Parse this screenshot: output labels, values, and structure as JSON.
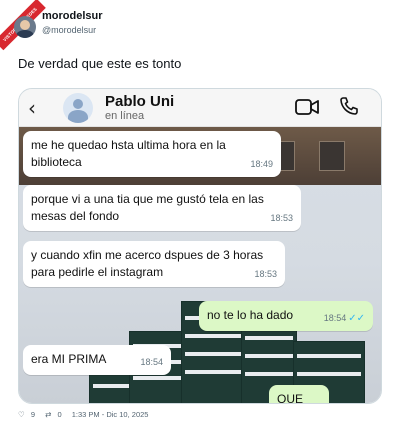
{
  "tweet": {
    "author_name": "morodelsur",
    "author_handle": "@morodelsur",
    "ribbon_text": "VISTOENLASREDES",
    "text": "De verdad que este es tonto",
    "footer": {
      "likes": "9",
      "retweets": "0",
      "timestamp": "1:33 PM - Dic 10, 2025"
    }
  },
  "chat": {
    "contact_name": "Pablo Uni",
    "contact_status": "en línea",
    "icons": [
      "back-chevron-icon",
      "contact-avatar-icon",
      "video-call-icon",
      "phone-call-icon",
      "double-check-icon"
    ],
    "colors": {
      "incoming": "#ffffff",
      "outgoing": "#dcf8c6",
      "ticks": "#34b7f1"
    },
    "messages": [
      {
        "text": "me he quedao hsta ultima hora en la biblioteca",
        "time": "18:49"
      },
      {
        "text": "porque vi a una tia que me gustó tela en las mesas del fondo",
        "time": "18:53"
      },
      {
        "text": "y cuando xfin me acerco dspues de 3 horas para pedirle el instagram",
        "time": "18:53"
      },
      {
        "text": "no te lo ha dado",
        "time": "18:54"
      },
      {
        "text": "era MI PRIMA",
        "time": "18:54"
      },
      {
        "text": "QUE"
      }
    ]
  }
}
